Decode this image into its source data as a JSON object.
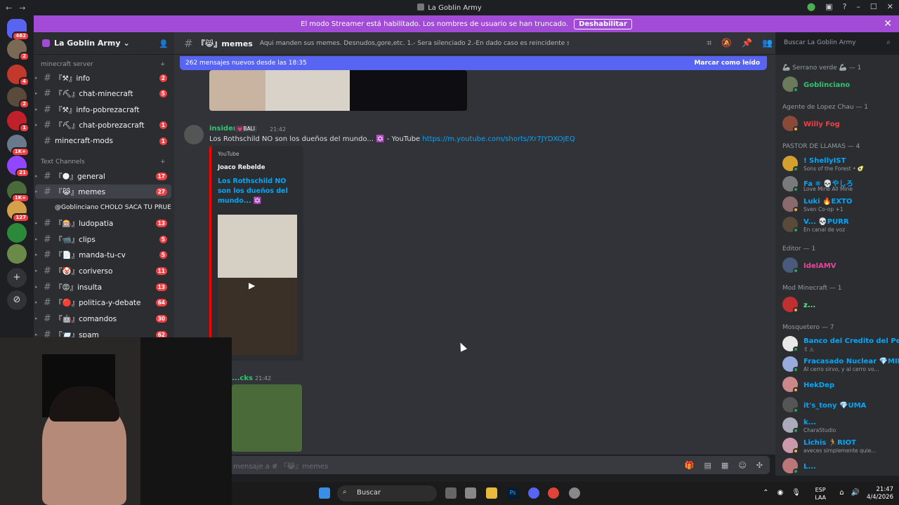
{
  "window": {
    "title": "La Goblin Army"
  },
  "banner": {
    "text": "El modo Streamer está habilitado. Los nombres de usuario se han truncado.",
    "button": "Deshabilitar"
  },
  "servers": [
    {
      "name": "discord-home",
      "badge": "462",
      "color": "#5865f2"
    },
    {
      "name": "server-1",
      "badge": "2",
      "color": "#7a6a55"
    },
    {
      "name": "server-2",
      "badge": "4",
      "color": "#c0392b"
    },
    {
      "name": "server-3",
      "badge": "2",
      "color": "#5a4a3a"
    },
    {
      "name": "server-4",
      "badge": "1",
      "color": "#c0202a"
    },
    {
      "name": "server-5",
      "badge": "1K+",
      "color": "#6a7a8a"
    },
    {
      "name": "server-6",
      "badge": "21",
      "color": "#9146ff"
    },
    {
      "name": "server-7",
      "badge": "1K+",
      "color": "#4a6a3a"
    },
    {
      "name": "server-8",
      "badge": "127",
      "color": "#d4a04a"
    },
    {
      "name": "server-9",
      "badge": "",
      "color": "#2a8a3a"
    },
    {
      "name": "server-10",
      "badge": "",
      "color": "#6a8a4a"
    }
  ],
  "sidebar": {
    "server_name": "La Goblin Army",
    "categories": [
      "minecraft server",
      "Text Channels"
    ],
    "channels": [
      {
        "label": "『⚒』info",
        "count": "2"
      },
      {
        "label": "『⛏』chat-minecraft",
        "count": "5"
      },
      {
        "label": "『⚒』info-pobrezacraft",
        "count": ""
      },
      {
        "label": "『⛏』chat-pobrezacraft",
        "count": "1"
      },
      {
        "label": "minecraft-mods",
        "count": "1"
      },
      {
        "label": "『🌑』general",
        "count": "17"
      },
      {
        "label": "『😹』memes",
        "count": "27"
      },
      {
        "label": "@Goblinciano CHOLO SACA TU PRUE...",
        "count": ""
      },
      {
        "label": "『🎰』ludopatia",
        "count": "13"
      },
      {
        "label": "『📹』clips",
        "count": "5"
      },
      {
        "label": "『📄』manda-tu-cv",
        "count": "5"
      },
      {
        "label": "『🤡』coriverso",
        "count": "11"
      },
      {
        "label": "『😡』insulta",
        "count": "13"
      },
      {
        "label": "『🔴』politica-y-debate",
        "count": "64"
      },
      {
        "label": "『🤖』comandos",
        "count": "30"
      },
      {
        "label": "『📨』spam",
        "count": "62"
      }
    ]
  },
  "header": {
    "channel": "『😹』memes",
    "topic": "Aqui manden sus memes. Desnudos,gore,etc. 1.- Sera silenciado 2.-En dado caso es reincidente sera baneado",
    "search_placeholder": "Buscar La Goblin Army"
  },
  "newbar": {
    "text": "262 mensajes nuevos desde las 18:35",
    "mark": "Marcar como leído"
  },
  "messages": [
    {
      "author": "insider",
      "tag": "💗BALI",
      "time": "21:42",
      "text": "Los Rothschild NO son los dueños del mundo... ✡️ - YouTube ",
      "link": "https://m.youtube.com/shorts/Xr7JYDXOjEQ",
      "embed": {
        "provider": "YouTube",
        "author": "Joaco Rebelde",
        "title": "Los Rothschild NO son los dueños del mundo... ✡️"
      }
    },
    {
      "author": "...cks",
      "time": "21:42"
    }
  ],
  "composer": {
    "placeholder": "mensaje a # 『😹』memes"
  },
  "members": {
    "roles": [
      "🦾 Serrano verde 🦾 — 1",
      "Agente de Lopez Chau — 1",
      "PASTOR DE LLAMAS — 4",
      "Editor — 1",
      "Mod Minecraft — 1",
      "Mosquetero — 7"
    ],
    "list": [
      {
        "name": "Goblinciano",
        "status": "",
        "color": "#2dc770"
      },
      {
        "name": "Willy Fog",
        "status": "",
        "color": "#ed4245"
      },
      {
        "name": "! ShellyIST",
        "status": "Sons of the Forest • 🥑",
        "color": "#00a8fc"
      },
      {
        "name": "Fa ❄ 💀やしろ",
        "status": "Love Mine All Mine",
        "color": "#00a8fc"
      },
      {
        "name": "Luki 🔥EXTO",
        "status": "Sven Co-op +1",
        "color": "#00a8fc"
      },
      {
        "name": "V... 💀PURR",
        "status": "En canal de voz",
        "color": "#00a8fc"
      },
      {
        "name": "IdelAMV",
        "status": "",
        "color": "#eb459e"
      },
      {
        "name": "z...",
        "status": "",
        "color": "#57f287"
      },
      {
        "name": "Banco del Credito del Perú",
        "status": "ꉂ ⚠",
        "color": "#00a8fc"
      },
      {
        "name": "Fracasado Nuclear 💎MIKU",
        "status": "Al cerro sirvo, y al cerro vo...",
        "color": "#00a8fc"
      },
      {
        "name": "HekDep",
        "status": "",
        "color": "#00a8fc"
      },
      {
        "name": "it's_tony 💎UMA",
        "status": "",
        "color": "#00a8fc"
      },
      {
        "name": "k...",
        "status": "CharaStudio",
        "color": "#00a8fc"
      },
      {
        "name": "Lichis 🏃RIOT",
        "status": "aveces simplemente quie...",
        "color": "#00a8fc"
      },
      {
        "name": "L...",
        "status": "",
        "color": "#00a8fc"
      }
    ]
  },
  "taskbar": {
    "search": "Buscar",
    "lang1": "ESP",
    "lang2": "LAA",
    "time": "21:47",
    "date": "4/4/2026"
  }
}
